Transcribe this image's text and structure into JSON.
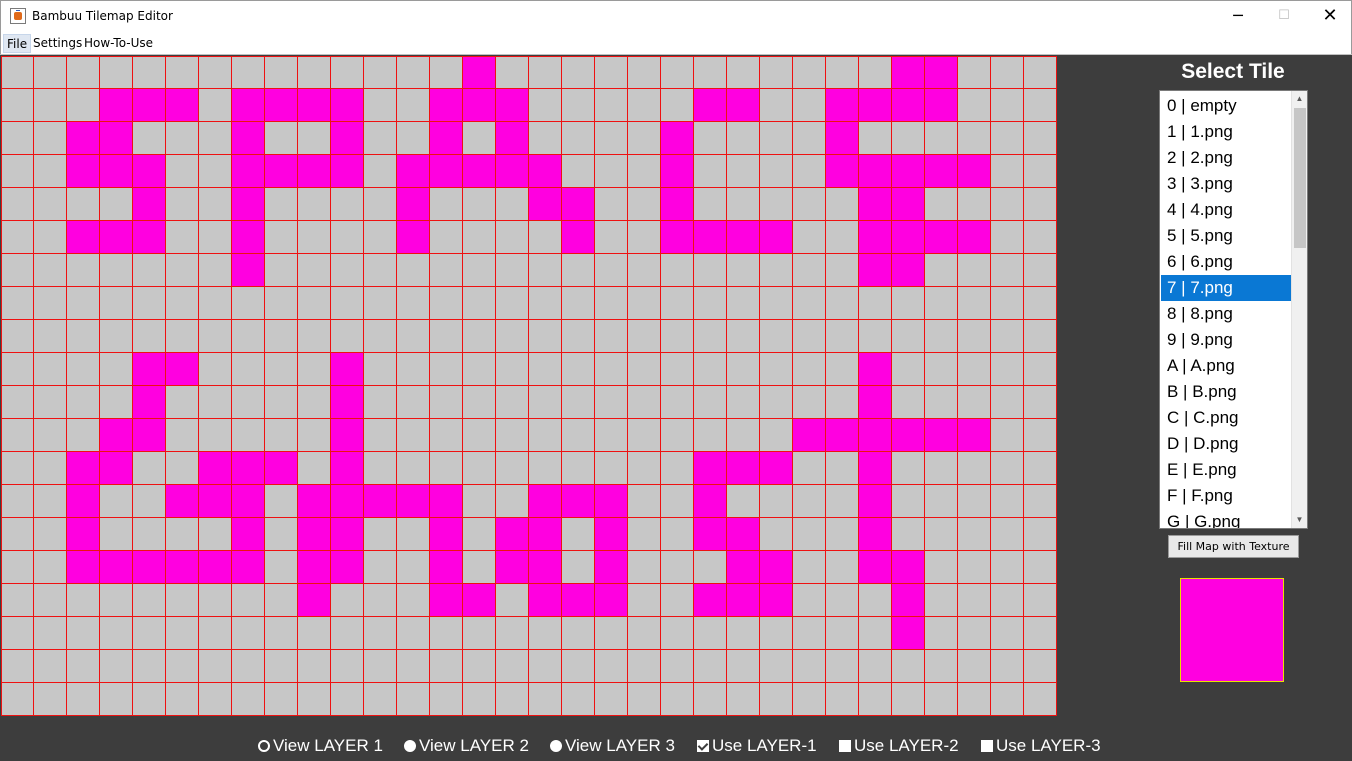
{
  "window": {
    "title": "Bambuu Tilemap Editor",
    "minimize_glyph": "─",
    "maximize_glyph": "☐",
    "close_glyph": "✕"
  },
  "menu": {
    "file": "File",
    "settings": "Settings",
    "how_to_use": "How-To-Use"
  },
  "colors": {
    "grid_background": "#c7c7c7",
    "grid_lines": "#ee1111",
    "tile_fill": "#ff00e0",
    "panel_background": "#3d3d3d",
    "selection": "#0a78d4"
  },
  "tilemap": {
    "columns": 32,
    "rows": 20,
    "filled_tile_color": "#ff00e0",
    "filled_cells": [
      [
        0,
        14
      ],
      [
        0,
        27
      ],
      [
        0,
        28
      ],
      [
        1,
        3
      ],
      [
        1,
        4
      ],
      [
        1,
        5
      ],
      [
        1,
        7
      ],
      [
        1,
        8
      ],
      [
        1,
        9
      ],
      [
        1,
        10
      ],
      [
        1,
        13
      ],
      [
        1,
        14
      ],
      [
        1,
        15
      ],
      [
        1,
        21
      ],
      [
        1,
        22
      ],
      [
        1,
        25
      ],
      [
        1,
        26
      ],
      [
        1,
        27
      ],
      [
        1,
        28
      ],
      [
        2,
        2
      ],
      [
        2,
        3
      ],
      [
        2,
        7
      ],
      [
        2,
        10
      ],
      [
        2,
        13
      ],
      [
        2,
        15
      ],
      [
        2,
        20
      ],
      [
        2,
        25
      ],
      [
        3,
        2
      ],
      [
        3,
        3
      ],
      [
        3,
        4
      ],
      [
        3,
        7
      ],
      [
        3,
        8
      ],
      [
        3,
        9
      ],
      [
        3,
        10
      ],
      [
        3,
        12
      ],
      [
        3,
        13
      ],
      [
        3,
        14
      ],
      [
        3,
        15
      ],
      [
        3,
        16
      ],
      [
        3,
        20
      ],
      [
        3,
        25
      ],
      [
        3,
        26
      ],
      [
        3,
        27
      ],
      [
        3,
        28
      ],
      [
        3,
        29
      ],
      [
        4,
        4
      ],
      [
        4,
        7
      ],
      [
        4,
        12
      ],
      [
        4,
        16
      ],
      [
        4,
        17
      ],
      [
        4,
        20
      ],
      [
        4,
        26
      ],
      [
        4,
        27
      ],
      [
        5,
        2
      ],
      [
        5,
        3
      ],
      [
        5,
        4
      ],
      [
        5,
        7
      ],
      [
        5,
        12
      ],
      [
        5,
        17
      ],
      [
        5,
        20
      ],
      [
        5,
        21
      ],
      [
        5,
        22
      ],
      [
        5,
        23
      ],
      [
        5,
        26
      ],
      [
        5,
        27
      ],
      [
        5,
        28
      ],
      [
        5,
        29
      ],
      [
        6,
        7
      ],
      [
        6,
        26
      ],
      [
        6,
        27
      ],
      [
        9,
        4
      ],
      [
        9,
        5
      ],
      [
        9,
        10
      ],
      [
        9,
        26
      ],
      [
        10,
        4
      ],
      [
        10,
        10
      ],
      [
        10,
        26
      ],
      [
        11,
        3
      ],
      [
        11,
        4
      ],
      [
        11,
        10
      ],
      [
        11,
        24
      ],
      [
        11,
        25
      ],
      [
        11,
        26
      ],
      [
        11,
        27
      ],
      [
        11,
        28
      ],
      [
        11,
        29
      ],
      [
        12,
        2
      ],
      [
        12,
        3
      ],
      [
        12,
        6
      ],
      [
        12,
        7
      ],
      [
        12,
        8
      ],
      [
        12,
        10
      ],
      [
        12,
        21
      ],
      [
        12,
        22
      ],
      [
        12,
        23
      ],
      [
        12,
        26
      ],
      [
        13,
        2
      ],
      [
        13,
        5
      ],
      [
        13,
        6
      ],
      [
        13,
        7
      ],
      [
        13,
        9
      ],
      [
        13,
        10
      ],
      [
        13,
        11
      ],
      [
        13,
        12
      ],
      [
        13,
        13
      ],
      [
        13,
        16
      ],
      [
        13,
        17
      ],
      [
        13,
        18
      ],
      [
        13,
        21
      ],
      [
        13,
        26
      ],
      [
        14,
        2
      ],
      [
        14,
        7
      ],
      [
        14,
        9
      ],
      [
        14,
        10
      ],
      [
        14,
        13
      ],
      [
        14,
        15
      ],
      [
        14,
        16
      ],
      [
        14,
        18
      ],
      [
        14,
        21
      ],
      [
        14,
        22
      ],
      [
        14,
        26
      ],
      [
        15,
        2
      ],
      [
        15,
        3
      ],
      [
        15,
        4
      ],
      [
        15,
        5
      ],
      [
        15,
        6
      ],
      [
        15,
        7
      ],
      [
        15,
        9
      ],
      [
        15,
        10
      ],
      [
        15,
        13
      ],
      [
        15,
        15
      ],
      [
        15,
        16
      ],
      [
        15,
        18
      ],
      [
        15,
        22
      ],
      [
        15,
        23
      ],
      [
        15,
        26
      ],
      [
        15,
        27
      ],
      [
        16,
        9
      ],
      [
        16,
        13
      ],
      [
        16,
        14
      ],
      [
        16,
        16
      ],
      [
        16,
        17
      ],
      [
        16,
        18
      ],
      [
        16,
        21
      ],
      [
        16,
        22
      ],
      [
        16,
        23
      ],
      [
        16,
        27
      ],
      [
        17,
        27
      ]
    ]
  },
  "tile_panel": {
    "title": "Select Tile",
    "items": [
      "0 | empty",
      "1 | 1.png",
      "2 | 2.png",
      "3 | 3.png",
      "4 | 4.png",
      "5 | 5.png",
      "6 | 6.png",
      "7 | 7.png",
      "8 | 8.png",
      "9 | 9.png",
      "A | A.png",
      "B | B.png",
      "C | C.png",
      "D | D.png",
      "E | E.png",
      "F | F.png",
      "G | G.png"
    ],
    "selected_index": 7,
    "scroll_up_icon": "▲",
    "scroll_down_icon": "▼",
    "fill_button": "Fill Map with Texture",
    "preview_color": "#ff00e0"
  },
  "layers": {
    "view_layer_1": "View LAYER 1",
    "view_layer_2": "View LAYER 2",
    "view_layer_3": "View LAYER 3",
    "use_layer_1": "Use LAYER-1",
    "use_layer_2": "Use LAYER-2",
    "use_layer_3": "Use LAYER-3",
    "use_layer_1_checked": true,
    "use_layer_2_checked": false,
    "use_layer_3_checked": false
  }
}
